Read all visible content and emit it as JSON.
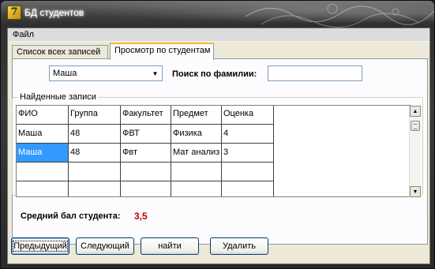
{
  "window": {
    "title": "БД студентов",
    "icon": "app-icon"
  },
  "menu": {
    "file_label": "Файл"
  },
  "tabs": [
    {
      "label": "Список всех записей",
      "active": false
    },
    {
      "label": "Просмотр по студентам",
      "active": true
    }
  ],
  "filter": {
    "combo_value": "Маша",
    "search_label": "Поиск по фамилии:",
    "search_value": ""
  },
  "results": {
    "group_label": "Найденные записи",
    "columns": [
      "ФИО",
      "Группа",
      "Факультет",
      "Предмет",
      "Оценка"
    ],
    "rows": [
      [
        "Маша",
        "48",
        "ФВТ",
        "Физика",
        "4"
      ],
      [
        "Маша",
        "48",
        "Фвт",
        "Мат анализ",
        "3"
      ]
    ],
    "selected_row": 1,
    "selected_col": 0
  },
  "average": {
    "label": "Средний бал студента:",
    "value": "3,5",
    "value_color": "#c00000"
  },
  "buttons": {
    "prev": "Предыдущий",
    "next": "Следующий",
    "find": "найти",
    "delete": "Удалить"
  }
}
